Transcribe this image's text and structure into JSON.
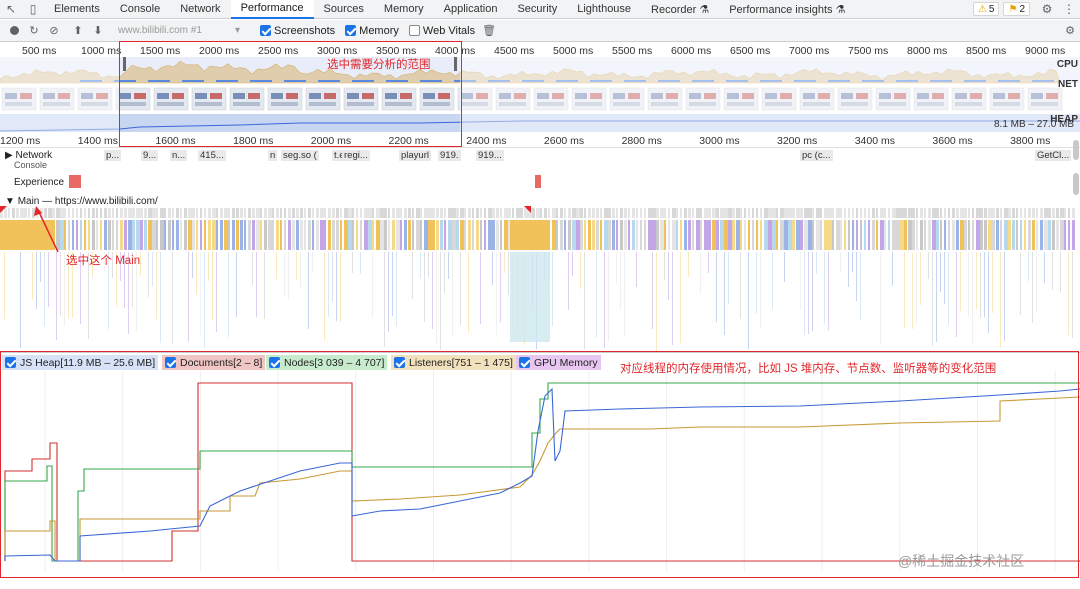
{
  "tabbar": {
    "tabs": [
      "Elements",
      "Console",
      "Network",
      "Performance",
      "Sources",
      "Memory",
      "Application",
      "Security",
      "Lighthouse",
      "Recorder ⚗",
      "Performance insights ⚗"
    ],
    "active": "Performance",
    "warnings_count": "5",
    "issues_count": "2"
  },
  "toolbar": {
    "recording_select": "www.bilibili.com #1",
    "screenshots_label": "Screenshots",
    "memory_label": "Memory",
    "web_vitals_label": "Web Vitals"
  },
  "overview": {
    "ruler": [
      "500 ms",
      "1000 ms",
      "1500 ms",
      "2000 ms",
      "2500 ms",
      "3000 ms",
      "3500 ms",
      "4000 ms",
      "4500 ms",
      "5000 ms",
      "5500 ms",
      "6000 ms",
      "6500 ms",
      "7000 ms",
      "7500 ms",
      "8000 ms",
      "8500 ms",
      "9000 ms",
      "95"
    ],
    "cpu_label": "CPU",
    "net_label": "NET",
    "heap_label": "HEAP",
    "heap_range": "8.1 MB – 27.0 MB"
  },
  "detail_ruler": [
    "1200 ms",
    "1400 ms",
    "1600 ms",
    "1800 ms",
    "2000 ms",
    "2200 ms",
    "2400 ms",
    "2600 ms",
    "2800 ms",
    "3000 ms",
    "3200 ms",
    "3400 ms",
    "3600 ms",
    "3800 ms"
  ],
  "tracks": {
    "network": "Network",
    "console": "Console",
    "experience": "Experience",
    "main": "Main — https://www.bilibili.com/"
  },
  "network_items": [
    "p...",
    "9...",
    "n...",
    "415...",
    "n",
    "seg.so (",
    "t.e",
    "regi...",
    "playurl",
    "919.",
    "919...",
    "pc (c...",
    "GetCl..."
  ],
  "legend": {
    "js_heap": "JS Heap[11.9 MB – 25.6 MB]",
    "documents": "Documents[2 – 8]",
    "nodes": "Nodes[3 039 – 4 707]",
    "listeners": "Listeners[751 – 1 475]",
    "gpu_memory": "GPU Memory"
  },
  "annotations": {
    "range_note": "选中需要分析的范围",
    "main_note": "选中这个 Main",
    "memory_note": "对应线程的内存使用情况，比如 JS 堆内存、节点数、监听器等的变化范围"
  },
  "watermark": "@稀土掘金技术社区",
  "colors": {
    "js_heap": "#3b67d6",
    "documents": "#d0312d",
    "nodes": "#34a84a",
    "listeners": "#c79a35",
    "gpu": "#a446c9",
    "annotation": "#e3262b"
  }
}
